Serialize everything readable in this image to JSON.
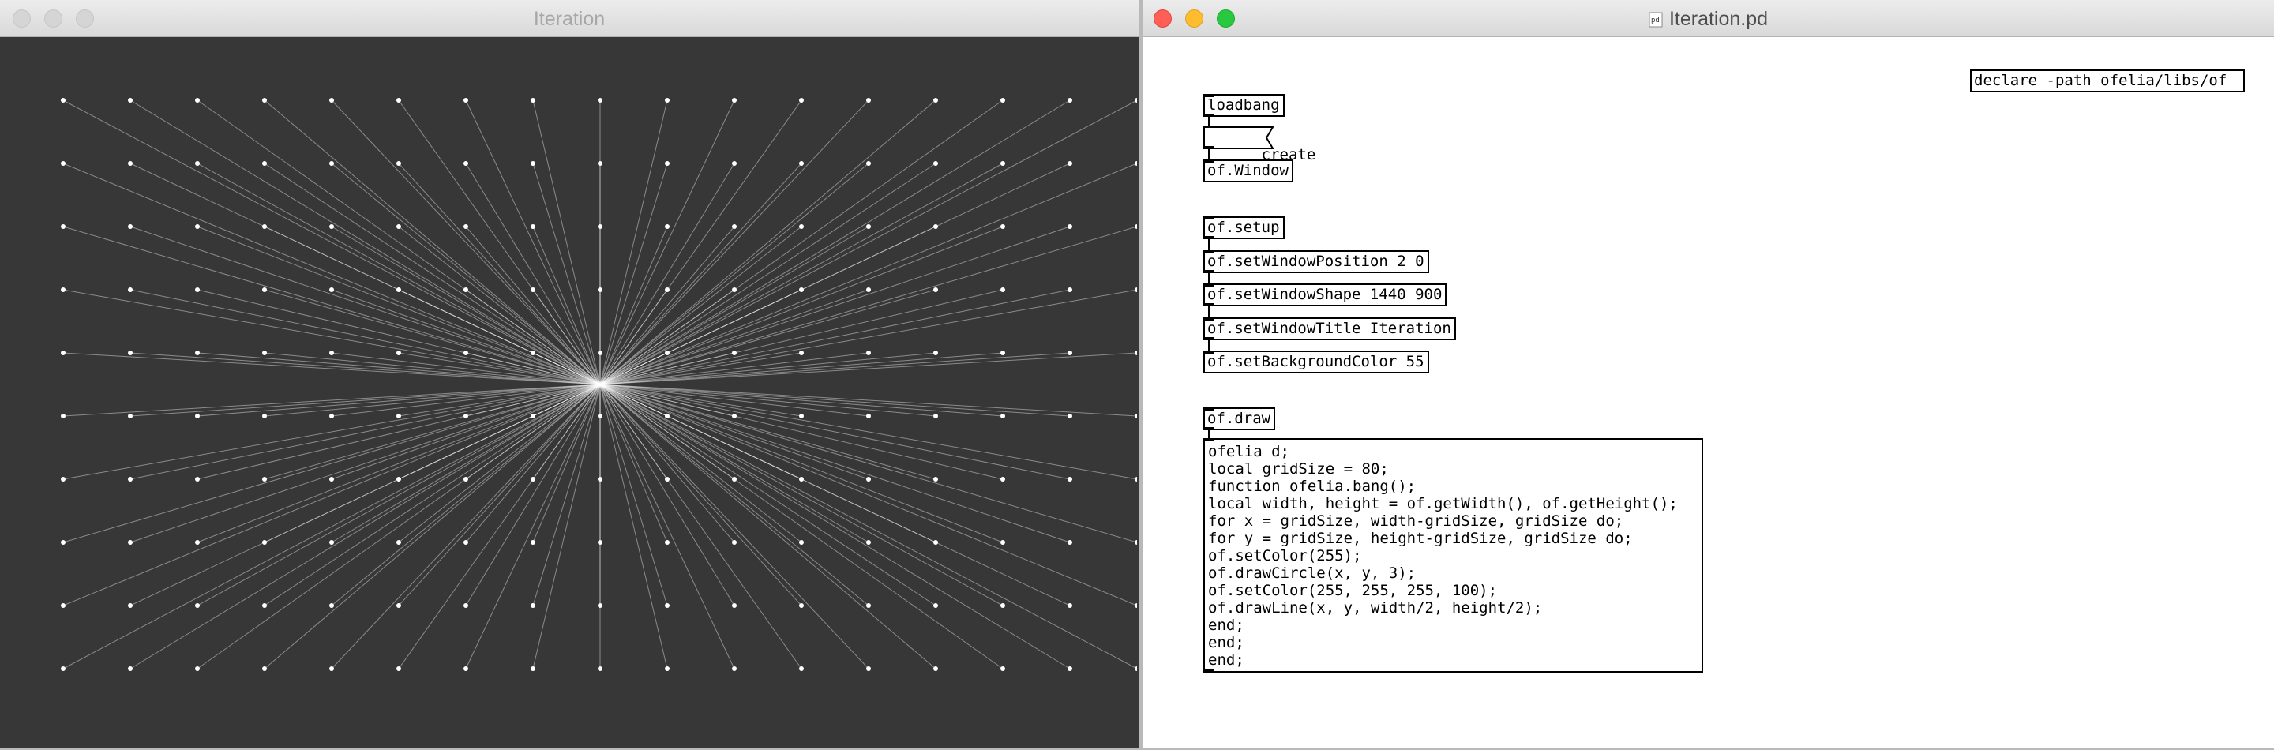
{
  "left_window": {
    "title": "Iteration",
    "grid": {
      "columns": 17,
      "rows": 10,
      "spacing": 80
    }
  },
  "right_window": {
    "title": "Iteration.pd",
    "declare": "declare -path ofelia/libs/of",
    "objects": {
      "loadbang": "loadbang",
      "create": "create",
      "window": "of.Window",
      "setup": "of.setup",
      "set_position": "of.setWindowPosition 2 0",
      "set_shape": "of.setWindowShape 1440 900",
      "set_title": "of.setWindowTitle Iteration",
      "set_bg": "of.setBackgroundColor 55",
      "draw": "of.draw"
    },
    "code_lines": [
      "ofelia d;",
      "local gridSize = 80;",
      "function ofelia.bang();",
      "local width, height = of.getWidth(), of.getHeight();",
      "for x = gridSize, width-gridSize, gridSize do;",
      "for y = gridSize, height-gridSize, gridSize do;",
      "of.setColor(255);",
      "of.drawCircle(x, y, 3);",
      "of.setColor(255, 255, 255, 100);",
      "of.drawLine(x, y, width/2, height/2);",
      "end;",
      "end;",
      "end;"
    ]
  },
  "colors": {
    "canvas_bg": "#373737",
    "close": "#ff5f57",
    "minimize": "#febc2e",
    "zoom": "#28c840"
  }
}
